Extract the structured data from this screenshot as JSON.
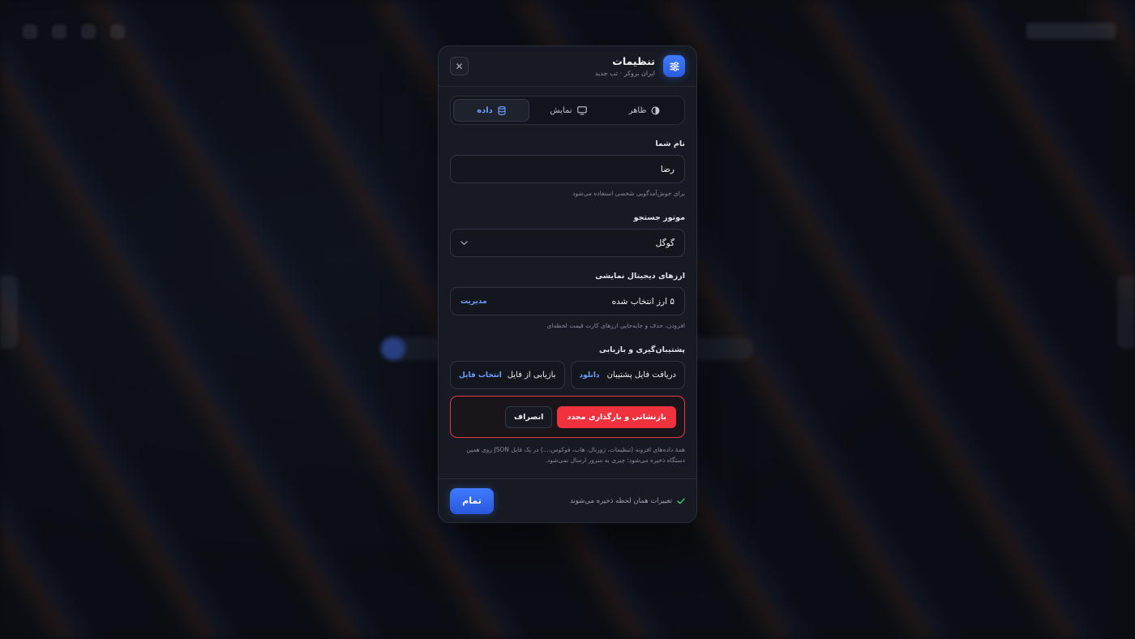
{
  "dialog": {
    "title": "تنظیمات",
    "subtitle": "ایران بروکر · تب جدید",
    "header_icon": "sliders-icon",
    "close_label": "✕"
  },
  "tabs": [
    {
      "label": "ظاهر",
      "icon": "contrast-icon",
      "active": false
    },
    {
      "label": "نمایش",
      "icon": "monitor-icon",
      "active": false
    },
    {
      "label": "داده",
      "icon": "database-icon",
      "active": true
    }
  ],
  "name_section": {
    "label": "نام شما",
    "value": "رضا",
    "hint": "برای خوش‌آمدگویی شخصی استفاده می‌شود"
  },
  "search_engine": {
    "label": "موتور جستجو",
    "selected": "گوگل"
  },
  "crypto": {
    "label": "ارزهای دیجیتال نمایشی",
    "summary": "۵ ارز انتخاب شده",
    "action": "مدیریت",
    "hint": "افزودن، حذف و جابه‌جایی ارزهای کارت قیمت لحظه‌ای"
  },
  "backup": {
    "label": "پشتیبان‌گیری و بازیابی",
    "download_text": "دریافت فایل پشتیبان",
    "download_action": "دانلود",
    "restore_text": "بازیابی از فایل",
    "restore_action": "انتخاب فایل"
  },
  "danger": {
    "reset_label": "بازنشانی و بارگذاری مجدد",
    "cancel_label": "انصراف",
    "note": "همهٔ داده‌های افزونه (تنظیمات، ژورنال، هاب، فوکوس،...) در یک فایل JSON روی همین دستگاه ذخیره می‌شود؛ چیزی به سرور ارسال نمی‌شود."
  },
  "footer": {
    "saved_text": "تغییرات همان لحظه ذخیره می‌شوند",
    "done_label": "تمام"
  },
  "colors": {
    "accent": "#3f7bff",
    "danger": "#f0323f",
    "success": "#3ed07a"
  }
}
